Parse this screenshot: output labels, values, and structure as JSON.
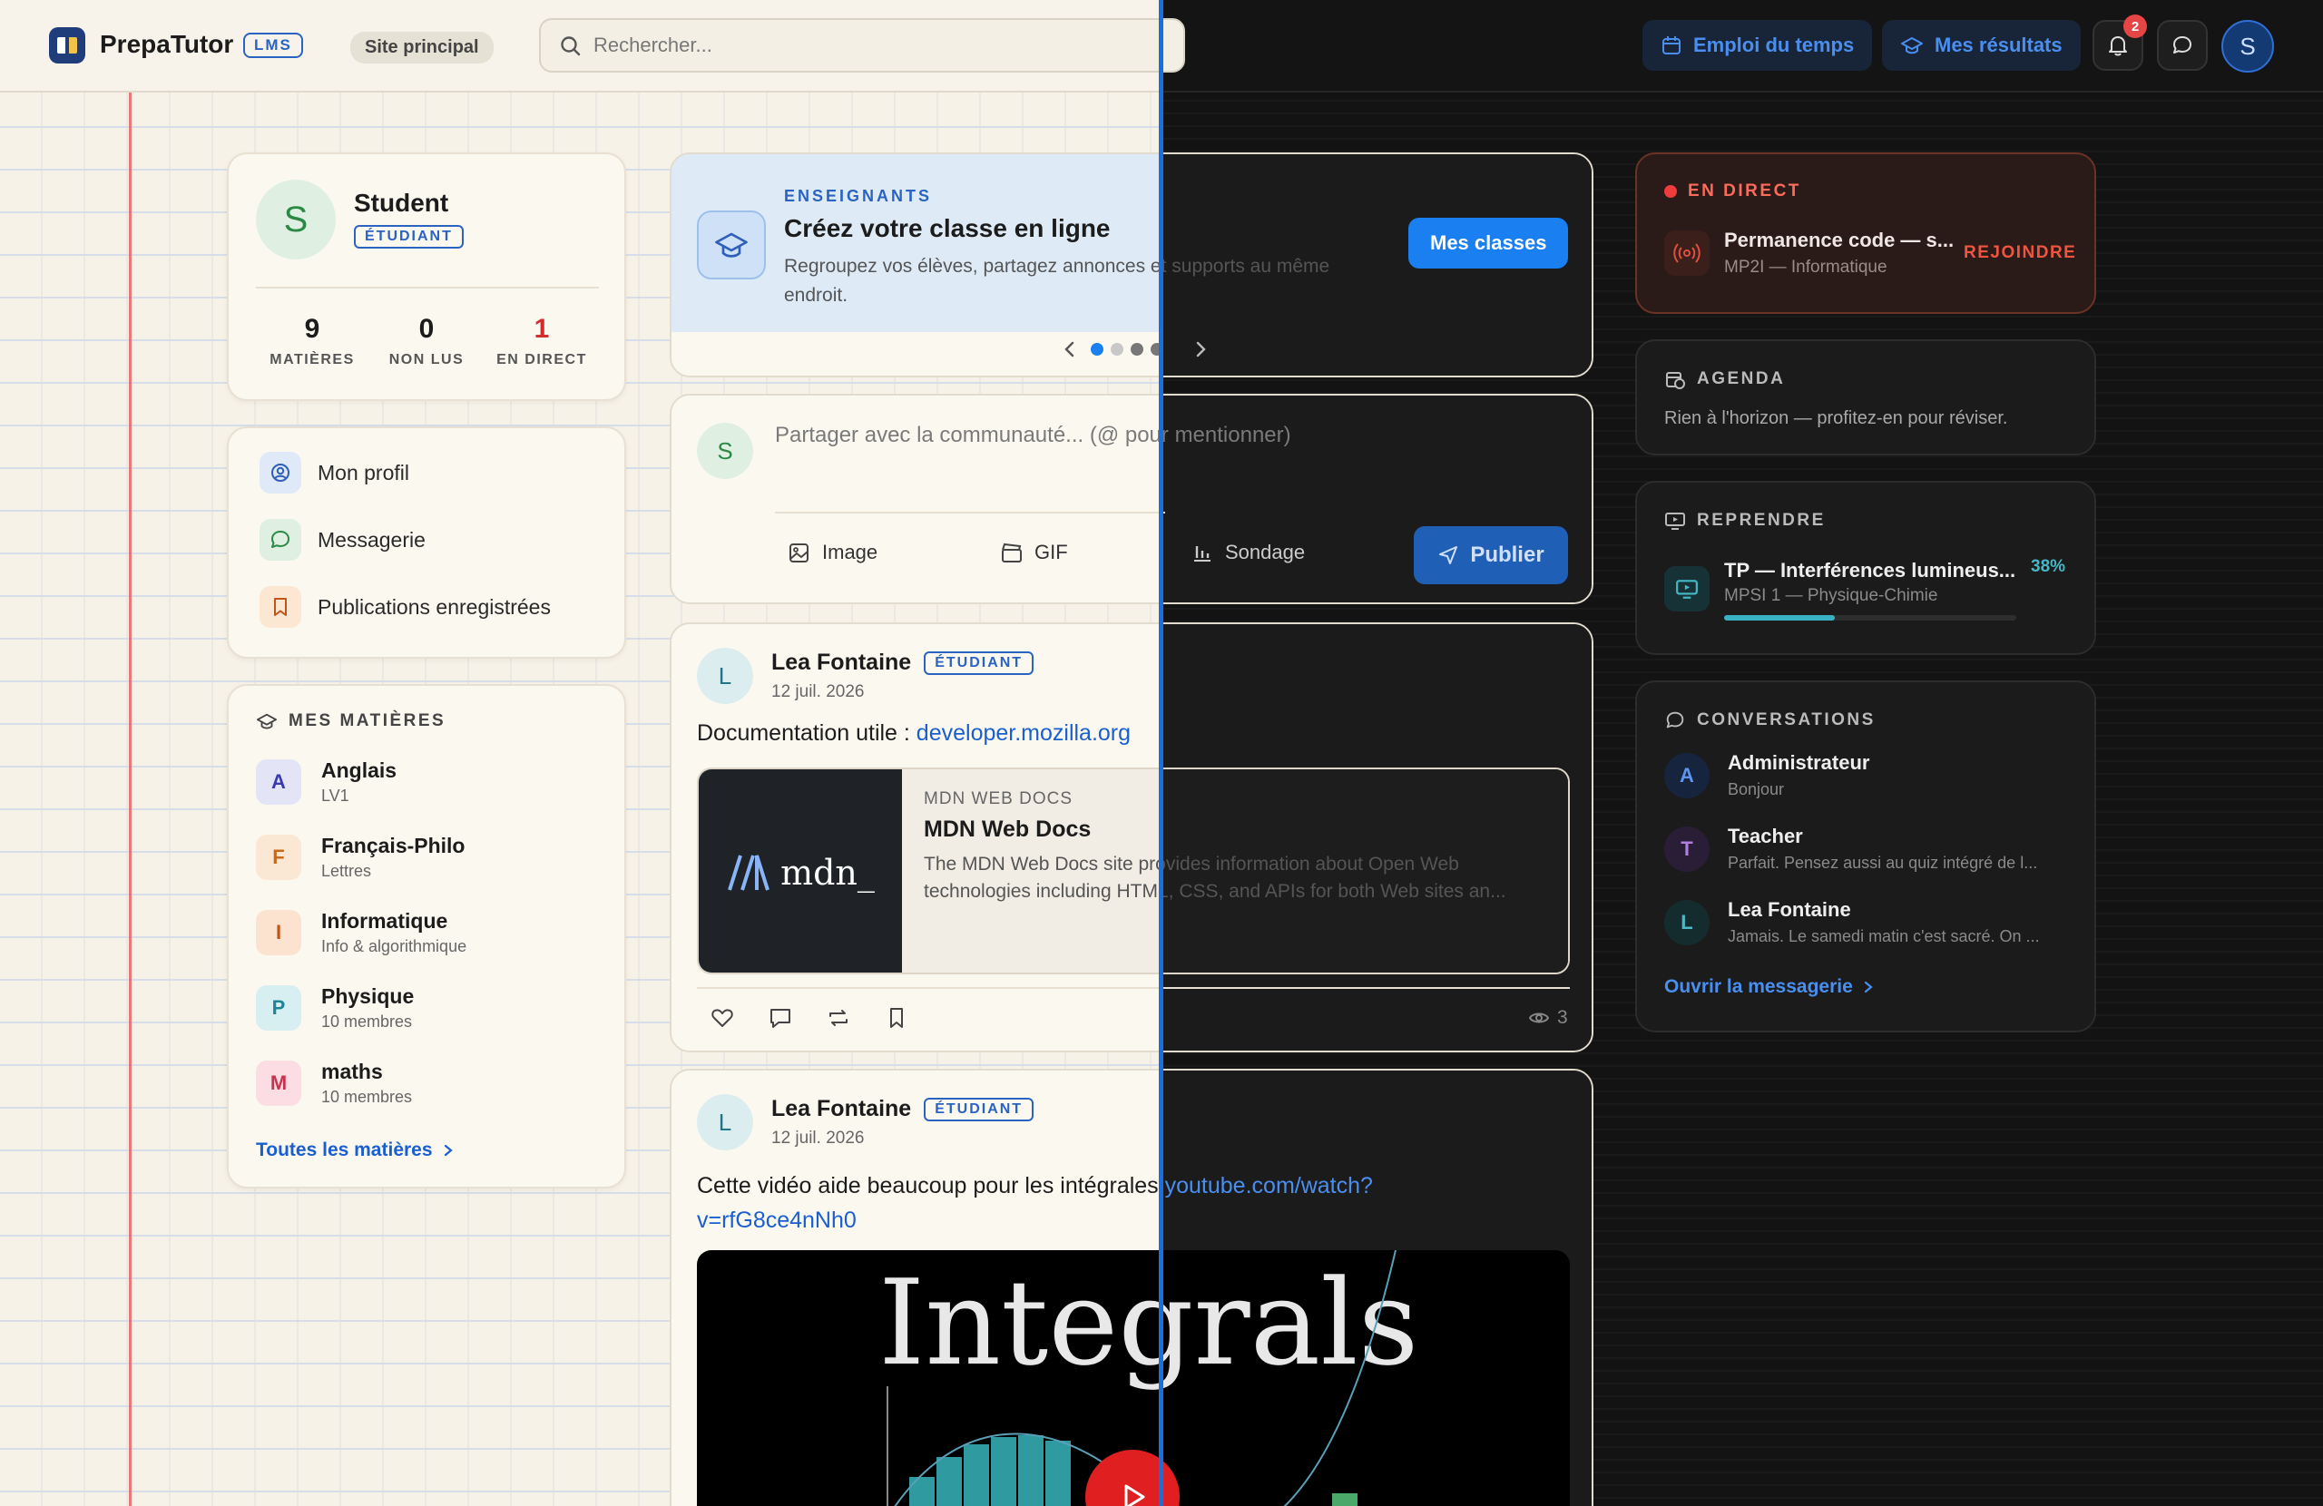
{
  "header": {
    "brand": "PrepaTutor",
    "brand_badge": "LMS",
    "site_pill": "Site principal",
    "search_placeholder": "Rechercher...",
    "schedule_btn": "Emploi du temps",
    "results_btn": "Mes résultats",
    "notif_count": "2",
    "avatar_letter": "S"
  },
  "profile": {
    "avatar": "S",
    "name": "Student",
    "role": "ÉTUDIANT",
    "stats": [
      {
        "value": "9",
        "label": "MATIÈRES"
      },
      {
        "value": "0",
        "label": "NON LUS"
      },
      {
        "value": "1",
        "label": "EN DIRECT"
      }
    ]
  },
  "nav": {
    "items": [
      {
        "label": "Mon profil",
        "icon": "user-circle-icon"
      },
      {
        "label": "Messagerie",
        "icon": "message-icon"
      },
      {
        "label": "Publications enregistrées",
        "icon": "bookmark-icon"
      }
    ]
  },
  "subjects": {
    "title": "MES MATIÈRES",
    "items": [
      {
        "letter": "A",
        "name": "Anglais",
        "sub": "LV1",
        "color": "#e4e4f7",
        "fg": "#3b3bb0"
      },
      {
        "letter": "F",
        "name": "Français-Philo",
        "sub": "Lettres",
        "color": "#fbe8d4",
        "fg": "#c46a1a"
      },
      {
        "letter": "I",
        "name": "Informatique",
        "sub": "Info & algorithmique",
        "color": "#fbe3cf",
        "fg": "#c0551c"
      },
      {
        "letter": "P",
        "name": "Physique",
        "sub": "10 membres",
        "color": "#d8eff2",
        "fg": "#1f8596"
      },
      {
        "letter": "M",
        "name": "maths",
        "sub": "10 membres",
        "color": "#fbdde3",
        "fg": "#c8324e"
      }
    ],
    "all_link": "Toutes les matières"
  },
  "banner": {
    "kicker": "ENSEIGNANTS",
    "title": "Créez votre classe en ligne",
    "body": "Regroupez vos élèves, partagez annonces et supports au même endroit.",
    "button": "Mes classes",
    "active_slide": 1,
    "slide_count": 4
  },
  "composer": {
    "avatar": "S",
    "placeholder": "Partager avec la communauté... (@ pour mentionner)",
    "image": "Image",
    "gif": "GIF",
    "poll": "Sondage",
    "publish": "Publier"
  },
  "posts": [
    {
      "avatar": "L",
      "author": "Lea Fontaine",
      "role": "ÉTUDIANT",
      "date": "12 juil. 2026",
      "text": "Documentation utile : ",
      "link": "developer.mozilla.org",
      "preview": {
        "site": "MDN WEB DOCS",
        "title": "MDN Web Docs",
        "desc": "The MDN Web Docs site provides information about Open Web technologies including HTML, CSS, and APIs for both Web sites an...",
        "logo": "mdn_"
      },
      "views": "3"
    },
    {
      "avatar": "L",
      "author": "Lea Fontaine",
      "role": "ÉTUDIANT",
      "date": "12 juil. 2026",
      "text": "Cette vidéo aide beaucoup pour les intégrales ",
      "link_a": "youtube.com/watch?",
      "link_b": "v=rfG8ce4nNh0",
      "video_title": "Integrals"
    }
  ],
  "live": {
    "kicker": "EN DIRECT",
    "title": "Permanence code — s...",
    "sub": "MP2I — Informatique",
    "action": "REJOINDRE"
  },
  "agenda": {
    "kicker": "AGENDA",
    "empty": "Rien à l'horizon — profitez-en pour réviser."
  },
  "resume": {
    "kicker": "REPRENDRE",
    "title": "TP — Interférences lumineus...",
    "sub": "MPSI 1 — Physique-Chimie",
    "percent_label": "38%",
    "progress": 0.38
  },
  "conversations": {
    "kicker": "CONVERSATIONS",
    "items": [
      {
        "letter": "A",
        "name": "Administrateur",
        "msg": "Bonjour",
        "bg": "#16243d",
        "fg": "#5b95f0"
      },
      {
        "letter": "T",
        "name": "Teacher",
        "msg": "Parfait. Pensez aussi au quiz intégré de l...",
        "bg": "#2a1d36",
        "fg": "#b07de0"
      },
      {
        "letter": "L",
        "name": "Lea Fontaine",
        "msg": "Jamais. Le samedi matin c'est sacré. On ...",
        "bg": "#152c2e",
        "fg": "#4fb7c4"
      }
    ],
    "open_link": "Ouvrir la messagerie"
  }
}
